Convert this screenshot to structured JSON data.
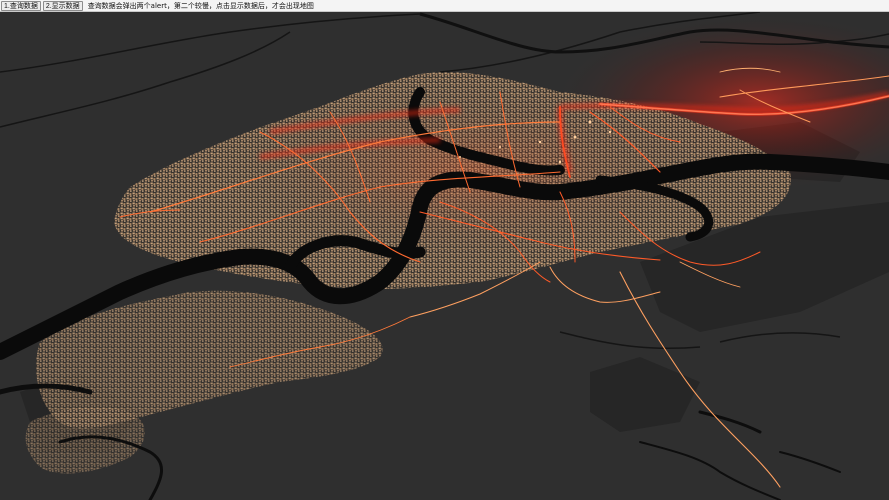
{
  "toolbar": {
    "query_button_label": "1.查询数据",
    "show_button_label": "2.显示数据",
    "hint_text": "查询数据会弹出两个alert，第二个较慢，点击显示数据后，才会出现地图"
  },
  "map": {
    "description_icon": "3d-city-map",
    "colors": {
      "background": "#2e2e2e",
      "land_dark": "#353535",
      "water": "#0b0b0b",
      "buildings": "#c9a27a",
      "road_glow": "#ff3a1e",
      "road_core": "#ffb27a"
    }
  }
}
